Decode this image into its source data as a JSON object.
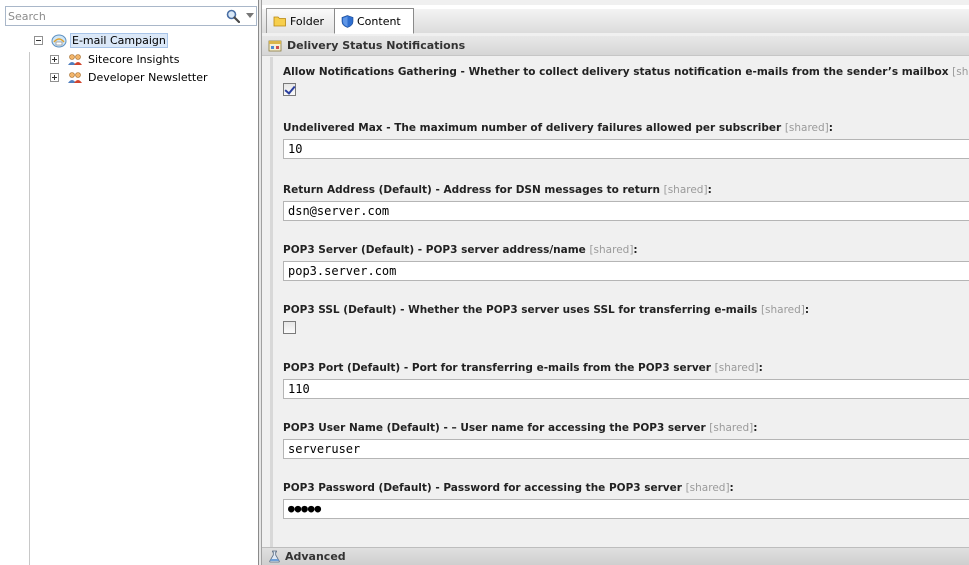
{
  "search": {
    "placeholder": "Search"
  },
  "tree": {
    "root": {
      "label": "E-mail Campaign"
    },
    "children": [
      {
        "label": "Sitecore Insights"
      },
      {
        "label": "Developer Newsletter"
      }
    ]
  },
  "tabs": [
    {
      "label": "Folder"
    },
    {
      "label": "Content"
    }
  ],
  "section": {
    "title": "Delivery Status Notifications"
  },
  "fields": [
    {
      "label": "Allow Notifications Gathering - Whether to collect delivery status notification e-mails from the sender’s mailbox",
      "shared": "[shared]",
      "type": "checkbox",
      "checked": true
    },
    {
      "label": "Undelivered Max - The maximum number of delivery failures allowed per subscriber",
      "shared": "[shared]",
      "type": "text",
      "value": "10"
    },
    {
      "label": "Return Address (Default) - Address for DSN messages to return",
      "shared": "[shared]",
      "type": "text",
      "value": "dsn@server.com"
    },
    {
      "label": "POP3 Server (Default) - POP3 server address/name",
      "shared": "[shared]",
      "type": "text",
      "value": "pop3.server.com"
    },
    {
      "label": "POP3 SSL (Default) - Whether the POP3 server uses SSL for transferring e-mails",
      "shared": "[shared]",
      "type": "checkbox",
      "checked": false
    },
    {
      "label": "POP3 Port (Default) - Port for transferring e-mails from the POP3 server",
      "shared": "[shared]",
      "type": "text",
      "value": "110"
    },
    {
      "label": "POP3 User Name (Default) - – User name for accessing the POP3 server",
      "shared": "[shared]",
      "type": "text",
      "value": "serveruser"
    },
    {
      "label": "POP3 Password (Default) - Password for accessing the POP3 server",
      "shared": "[shared]",
      "type": "password",
      "value": "●●●●●"
    }
  ],
  "advanced": {
    "title": "Advanced"
  },
  "colors": {
    "selection": "#dbe8f8",
    "panel": "#f0f0f0",
    "header": "#d6d6d6"
  }
}
